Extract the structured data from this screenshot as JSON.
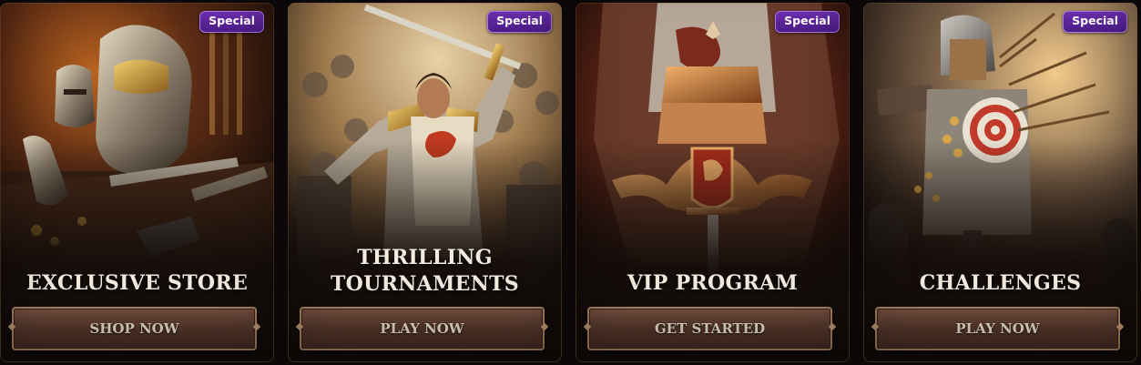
{
  "badge_label": "Special",
  "cards": [
    {
      "title_lines": [
        "EXCLUSIVE STORE"
      ],
      "button_label": "SHOP NOW",
      "art": "armor-shop-art"
    },
    {
      "title_lines": [
        "THRILLING",
        "TOURNAMENTS"
      ],
      "button_label": "PLAY NOW",
      "art": "knight-crowd-art"
    },
    {
      "title_lines": [
        "VIP PROGRAM"
      ],
      "button_label": "GET STARTED",
      "art": "knight-crest-art"
    },
    {
      "title_lines": [
        "CHALLENGES"
      ],
      "button_label": "PLAY NOW",
      "art": "archery-target-art"
    }
  ],
  "colors": {
    "badge": "#5a24a0",
    "button": "#5a3a2d",
    "button_border": "#b28a63",
    "title": "#f4ece0",
    "background": "#0c0807"
  }
}
